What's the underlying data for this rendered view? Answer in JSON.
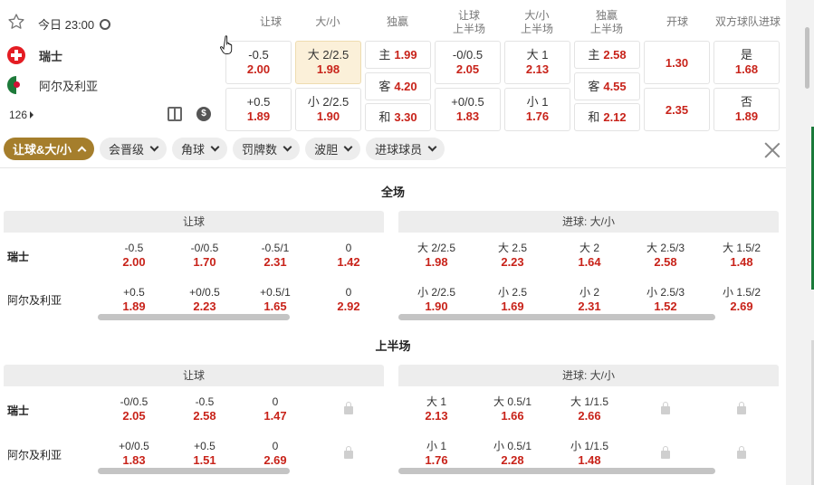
{
  "match": {
    "datetime": "今日 23:00",
    "home": "瑞士",
    "away": "阿尔及利亚",
    "count": "126"
  },
  "columns": {
    "handicap": "让球",
    "overunder": "大/小",
    "win": "独赢",
    "h1_handicap_l1": "让球",
    "h1_handicap_l2": "上半场",
    "h1_overunder_l1": "大/小",
    "h1_overunder_l2": "上半场",
    "h1_win_l1": "独赢",
    "h1_win_l2": "上半场",
    "kickoff": "开球",
    "btts": "双方球队进球"
  },
  "odds": {
    "hdp_home_line": "-0.5",
    "hdp_home_odd": "2.00",
    "hdp_away_line": "+0.5",
    "hdp_away_odd": "1.89",
    "ou_over_line": "大 2/2.5",
    "ou_over_odd": "1.98",
    "ou_under_line": "小 2/2.5",
    "ou_under_odd": "1.90",
    "win_home_label": "主",
    "win_home_odd": "1.99",
    "win_away_label": "客",
    "win_away_odd": "4.20",
    "win_draw_label": "和",
    "win_draw_odd": "3.30",
    "h1hdp_home_line": "-0/0.5",
    "h1hdp_home_odd": "2.05",
    "h1hdp_away_line": "+0/0.5",
    "h1hdp_away_odd": "1.83",
    "h1ou_over_line": "大 1",
    "h1ou_over_odd": "2.13",
    "h1ou_under_line": "小 1",
    "h1ou_under_odd": "1.76",
    "h1win_home_label": "主",
    "h1win_home_odd": "2.58",
    "h1win_away_label": "客",
    "h1win_away_odd": "4.55",
    "h1win_draw_label": "和",
    "h1win_draw_odd": "2.12",
    "kickoff_home_odd": "1.30",
    "kickoff_away_odd": "2.35",
    "btts_yes_label": "是",
    "btts_yes_odd": "1.68",
    "btts_no_label": "否",
    "btts_no_odd": "1.89"
  },
  "tabs": [
    "让球&大/小",
    "会晋级",
    "角球",
    "罚牌数",
    "波胆",
    "进球球员"
  ],
  "full": {
    "title": "全场",
    "handicap_title": "让球",
    "ou_title": "进球: 大/小",
    "home": "瑞士",
    "away": "阿尔及利亚",
    "hdp_home": [
      [
        "-0.5",
        "2.00"
      ],
      [
        "-0/0.5",
        "1.70"
      ],
      [
        "-0.5/1",
        "2.31"
      ],
      [
        "0",
        "1.42"
      ]
    ],
    "hdp_away": [
      [
        "+0.5",
        "1.89"
      ],
      [
        "+0/0.5",
        "2.23"
      ],
      [
        "+0.5/1",
        "1.65"
      ],
      [
        "0",
        "2.92"
      ]
    ],
    "ou_over": [
      [
        "大 2/2.5",
        "1.98"
      ],
      [
        "大 2.5",
        "2.23"
      ],
      [
        "大 2",
        "1.64"
      ],
      [
        "大 2.5/3",
        "2.58"
      ],
      [
        "大 1.5/2",
        "1.48"
      ]
    ],
    "ou_under": [
      [
        "小 2/2.5",
        "1.90"
      ],
      [
        "小 2.5",
        "1.69"
      ],
      [
        "小 2",
        "2.31"
      ],
      [
        "小 2.5/3",
        "1.52"
      ],
      [
        "小 1.5/2",
        "2.69"
      ]
    ]
  },
  "half": {
    "title": "上半场",
    "handicap_title": "让球",
    "ou_title": "进球: 大/小",
    "home": "瑞士",
    "away": "阿尔及利亚",
    "hdp_home": [
      [
        "-0/0.5",
        "2.05"
      ],
      [
        "-0.5",
        "2.58"
      ],
      [
        "0",
        "1.47"
      ]
    ],
    "hdp_away": [
      [
        "+0/0.5",
        "1.83"
      ],
      [
        "+0.5",
        "1.51"
      ],
      [
        "0",
        "2.69"
      ]
    ],
    "ou_over": [
      [
        "大 1",
        "2.13"
      ],
      [
        "大 0.5/1",
        "1.66"
      ],
      [
        "大 1/1.5",
        "2.66"
      ]
    ],
    "ou_under": [
      [
        "小 1",
        "1.76"
      ],
      [
        "小 0.5/1",
        "2.28"
      ],
      [
        "小 1/1.5",
        "1.48"
      ]
    ]
  },
  "colors": {
    "accent": "#a57e2c",
    "odds": "#c8231a",
    "selected": "#fbf0d9"
  }
}
